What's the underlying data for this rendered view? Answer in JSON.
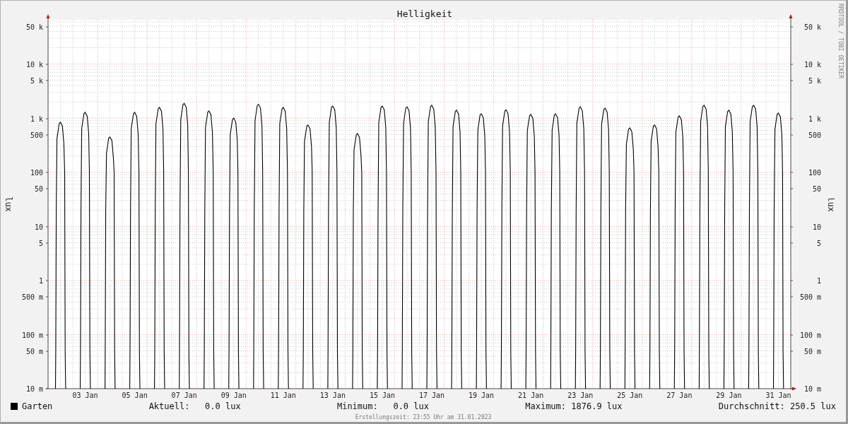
{
  "graph": {
    "title": "Helligkeit",
    "y_label": "lux",
    "y_tick_labels": [
      "50 k",
      "10 k",
      "5 k",
      "1 k",
      "500",
      "100",
      "50",
      "10",
      "5",
      "1",
      "500 m",
      "100 m",
      "50 m",
      "10 m"
    ],
    "right_y_label": "lux",
    "right_y_tick_labels": [
      "50 k",
      "10 k",
      "5 k",
      "1 k",
      "500",
      "100",
      "50",
      "10",
      "5",
      "1",
      "500 m",
      "100 m",
      "50 m",
      "10 m"
    ],
    "x_tick_labels": [
      "03 Jan",
      "05 Jan",
      "07 Jan",
      "09 Jan",
      "11 Jan",
      "13 Jan",
      "15 Jan",
      "17 Jan",
      "19 Jan",
      "21 Jan",
      "23 Jan",
      "25 Jan",
      "27 Jan",
      "29 Jan",
      "31 Jan"
    ],
    "legend": [
      {
        "label": "Garten",
        "color": "#000000"
      }
    ],
    "statistics": [
      "Aktuell:   0.0 lux",
      "Minimum:   0.0 lux",
      "Maximum: 1876.9 lux",
      "Durchschnitt: 250.5 lux"
    ]
  },
  "credit": "RRDTOOL / TOBI OETIKER",
  "footer": "Erstellungszeit: 23:55 Uhr am 31.01.2023"
}
